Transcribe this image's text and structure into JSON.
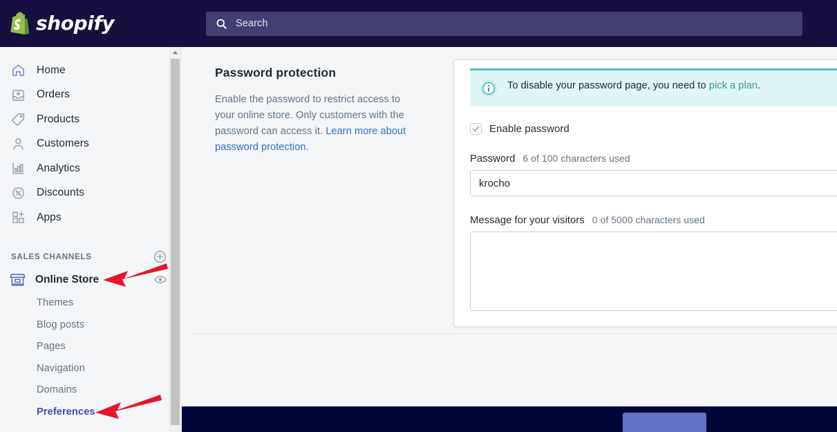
{
  "header": {
    "brand_name": "shopify",
    "logo_icon": "shopify-bag-logo",
    "search": {
      "icon": "search-icon",
      "placeholder": "Search",
      "value": ""
    }
  },
  "sidebar": {
    "nav_items": [
      {
        "label": "Home",
        "icon": "home-icon"
      },
      {
        "label": "Orders",
        "icon": "orders-inbox-icon"
      },
      {
        "label": "Products",
        "icon": "products-tag-icon"
      },
      {
        "label": "Customers",
        "icon": "customers-person-icon"
      },
      {
        "label": "Analytics",
        "icon": "analytics-bar-chart-icon"
      },
      {
        "label": "Discounts",
        "icon": "discounts-percent-icon"
      },
      {
        "label": "Apps",
        "icon": "apps-grid-plus-icon"
      }
    ],
    "section": {
      "title": "SALES CHANNELS",
      "add_icon": "plus-circle-icon"
    },
    "channel": {
      "label": "Online Store",
      "icon": "online-store-icon",
      "view_icon": "eye-icon"
    },
    "sub_items": [
      {
        "label": "Themes",
        "active": false
      },
      {
        "label": "Blog posts",
        "active": false
      },
      {
        "label": "Pages",
        "active": false
      },
      {
        "label": "Navigation",
        "active": false
      },
      {
        "label": "Domains",
        "active": false
      },
      {
        "label": "Preferences",
        "active": true
      }
    ],
    "scrollbar": {
      "up_icon": "scroll-up-arrow-icon"
    }
  },
  "main": {
    "section_heading": "Password protection",
    "section_description_part1": "Enable the password to restrict access to your online store. Only customers with the password can access it. ",
    "section_description_link": "Learn more about password protection",
    "section_description_part2": ".",
    "banner": {
      "icon": "info-circle-icon",
      "text_part1": "To disable your password page, you need to ",
      "link_text": "pick a plan",
      "text_part2": "."
    },
    "enable_password": {
      "label": "Enable password",
      "checked": true,
      "check_icon": "checkmark-icon"
    },
    "password_field": {
      "label": "Password",
      "counter": "6 of 100 characters used",
      "value": "krocho",
      "placeholder": ""
    },
    "message_field": {
      "label": "Message for your visitors",
      "counter": "0 of 5000 characters used",
      "value": "",
      "placeholder": ""
    }
  },
  "savebar": {
    "save_label": ""
  },
  "annotations": [
    {
      "name": "arrow-pointing-to-online-store",
      "color": "#e8152a"
    },
    {
      "name": "arrow-pointing-to-preferences",
      "color": "#e8152a"
    }
  ],
  "colors": {
    "topbar_bg": "#160f40",
    "savebar_bg": "#000639",
    "accent_teal": "#47c1bf",
    "banner_bg": "#e0f5f5",
    "link_blue": "#2f6ecc",
    "active_nav": "#3f4eae",
    "annotation_red": "#e8152a"
  }
}
